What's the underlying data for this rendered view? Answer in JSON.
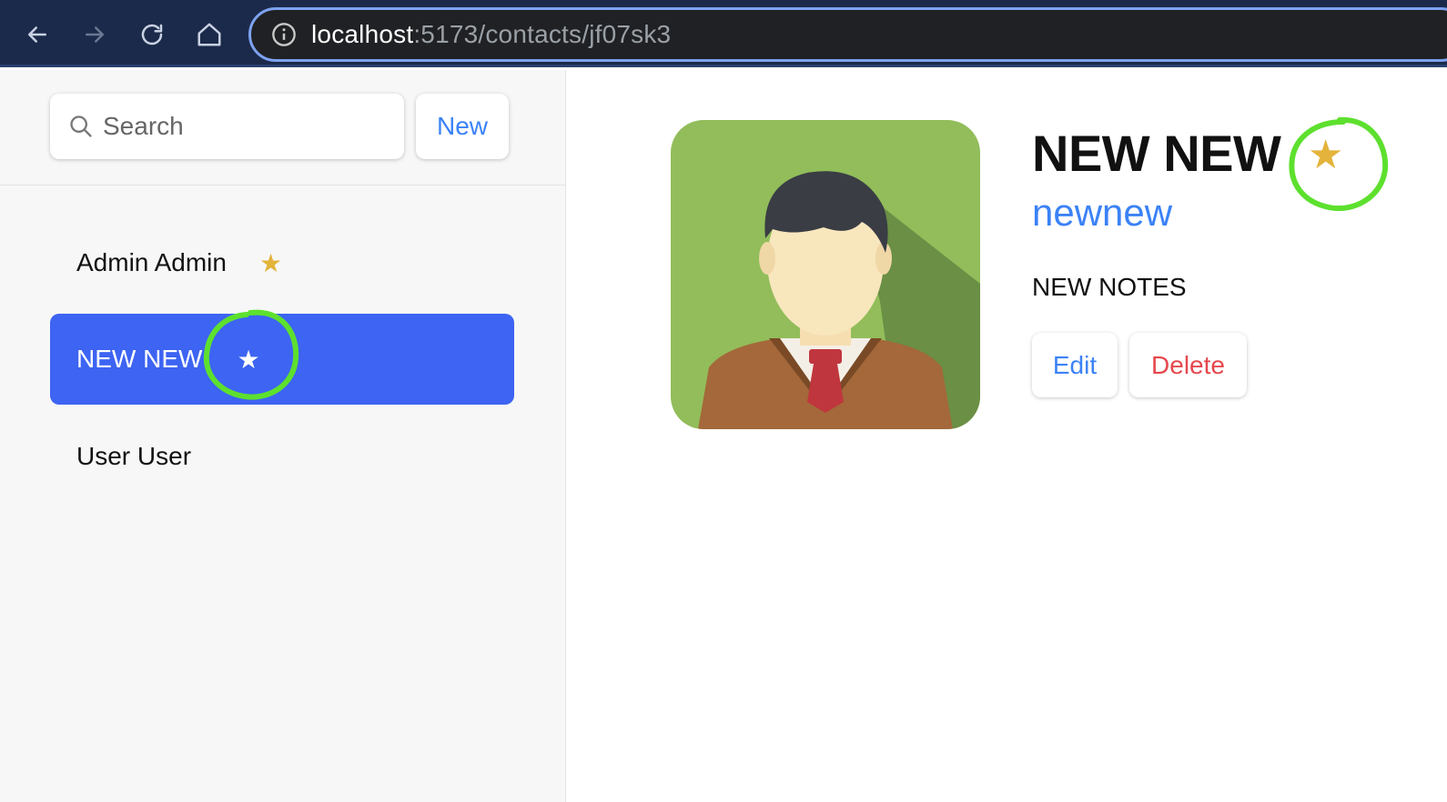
{
  "browser": {
    "url_host": "localhost",
    "url_rest": ":5173/contacts/jf07sk3",
    "icons": [
      "back-arrow-icon",
      "forward-arrow-icon",
      "reload-icon",
      "home-icon",
      "info-icon"
    ]
  },
  "sidebar": {
    "search_placeholder": "Search",
    "new_label": "New",
    "contacts": [
      {
        "name": "Admin Admin",
        "favorite": true,
        "star": "★"
      },
      {
        "name": "NEW NEW",
        "favorite": true,
        "star": "★",
        "active": true
      },
      {
        "name": "User User",
        "favorite": false
      }
    ]
  },
  "contact": {
    "name": "NEW NEW",
    "favorite_star": "★",
    "handle": "newnew",
    "notes": "NEW NOTES",
    "edit_label": "Edit",
    "delete_label": "Delete"
  },
  "colors": {
    "accent": "#3b82f6",
    "active_item": "#3d64f2",
    "star": "#e3b33b",
    "danger": "#e5484d",
    "annotation": "#5de02e"
  }
}
